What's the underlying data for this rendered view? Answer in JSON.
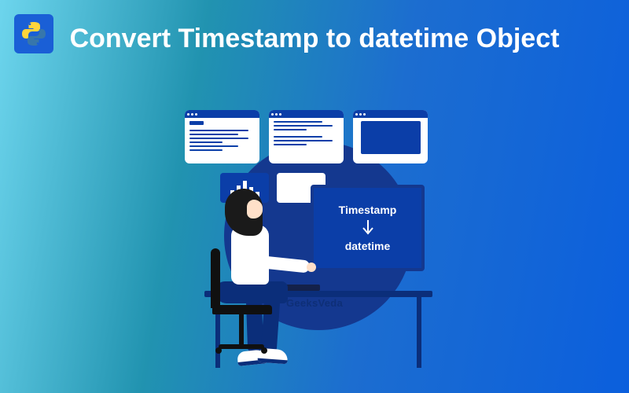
{
  "logo_name": "python-logo",
  "title": "Convert Timestamp to datetime Object",
  "monitor": {
    "top_label": "Timestamp",
    "bottom_label": "datetime"
  },
  "watermark": "GeeksVeda"
}
